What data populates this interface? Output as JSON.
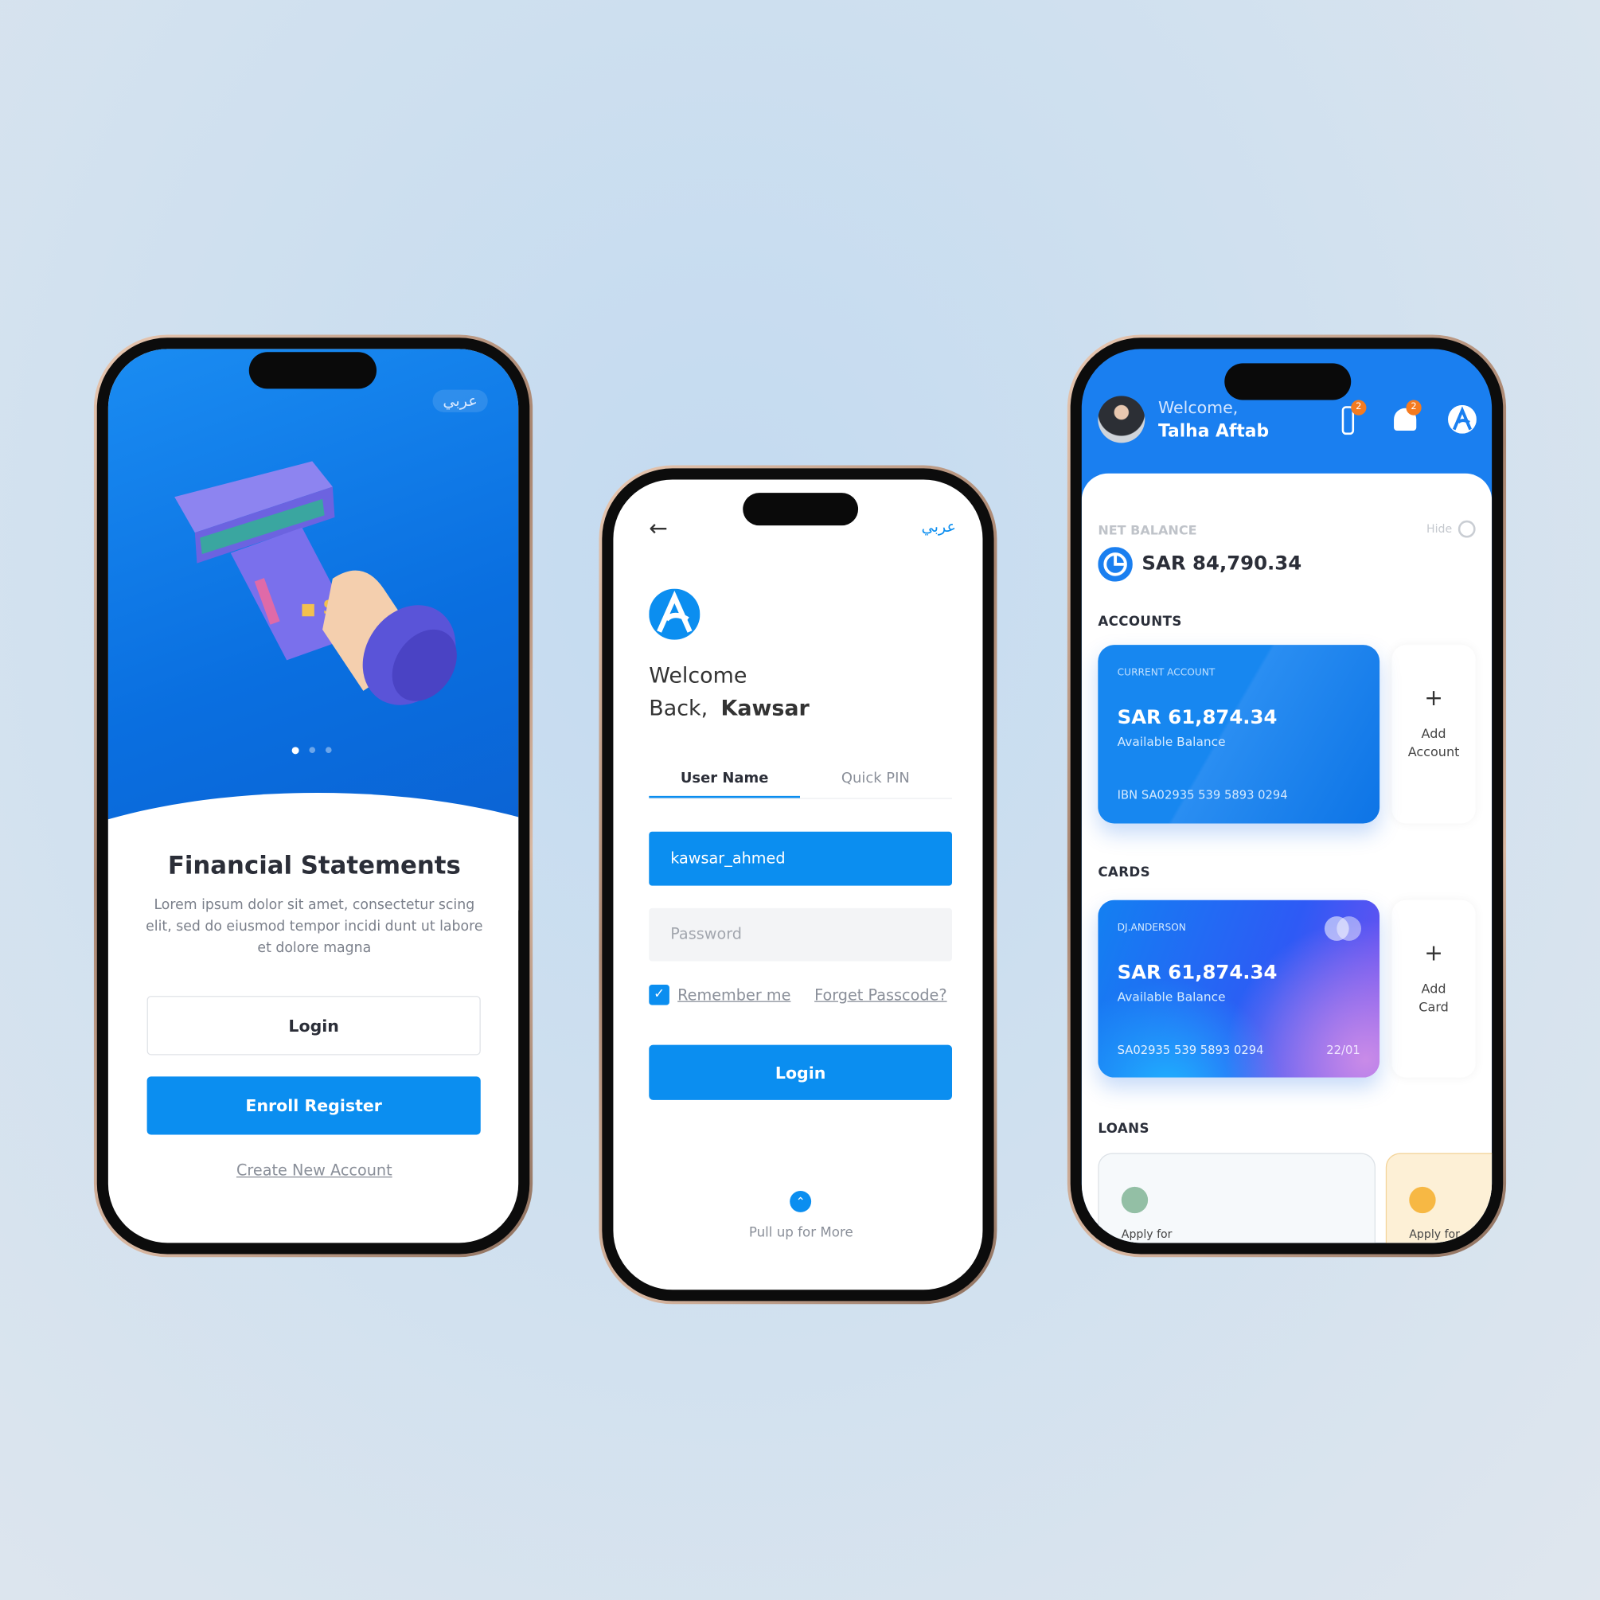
{
  "colors": {
    "primary": "#0b8ef0",
    "header_blue": "#1a7ff0",
    "orange_badge": "#f47b20"
  },
  "onboarding": {
    "language_toggle": "عربي",
    "carousel": {
      "pages": 3,
      "active": 1
    },
    "title": "Financial Statements",
    "description": "Lorem ipsum dolor sit amet, consectetur scing elit, sed do eiusmod tempor incidi dunt ut labore et dolore magna",
    "login_label": "Login",
    "enroll_label": "Enroll Register",
    "create_account_link": "Create New Account"
  },
  "login": {
    "language_toggle": "عربي",
    "welcome_line1": "Welcome",
    "welcome_line2": "Back,",
    "user_name": "Kawsar",
    "tabs": [
      {
        "label": "User Name",
        "active": true
      },
      {
        "label": "Quick PIN",
        "active": false
      }
    ],
    "username_value": "kawsar_ahmed",
    "password_placeholder": "Password",
    "remember_me": "Remember me",
    "remember_checked": true,
    "forgot_link": "Forget Passcode?",
    "login_label": "Login",
    "pull_up": "Pull up for More"
  },
  "dashboard": {
    "welcome": "Welcome,",
    "user_name": "Talha Aftab",
    "traffic_badge": "2",
    "bell_badge": "2",
    "net_balance_label": "NET BALANCE",
    "hide_label": "Hide",
    "net_balance": "SAR 84,790.34",
    "accounts_title": "ACCOUNTS",
    "account": {
      "type": "CURRENT ACCOUNT",
      "balance": "SAR 61,874.34",
      "balance_label": "Available Balance",
      "iban": "IBN SA02935 539 5893 0294"
    },
    "add_account": [
      "Add",
      "Account"
    ],
    "cards_title": "CARDS",
    "card": {
      "holder": "DJ.ANDERSON",
      "balance": "SAR 61,874.34",
      "balance_label": "Available Balance",
      "number": "SA02935 539 5893 0294",
      "expiry": "22/01"
    },
    "add_card": [
      "Add",
      "Card"
    ],
    "loans_title": "LOANS",
    "loans": [
      {
        "label": "Apply for"
      },
      {
        "label": "Apply for"
      }
    ]
  }
}
